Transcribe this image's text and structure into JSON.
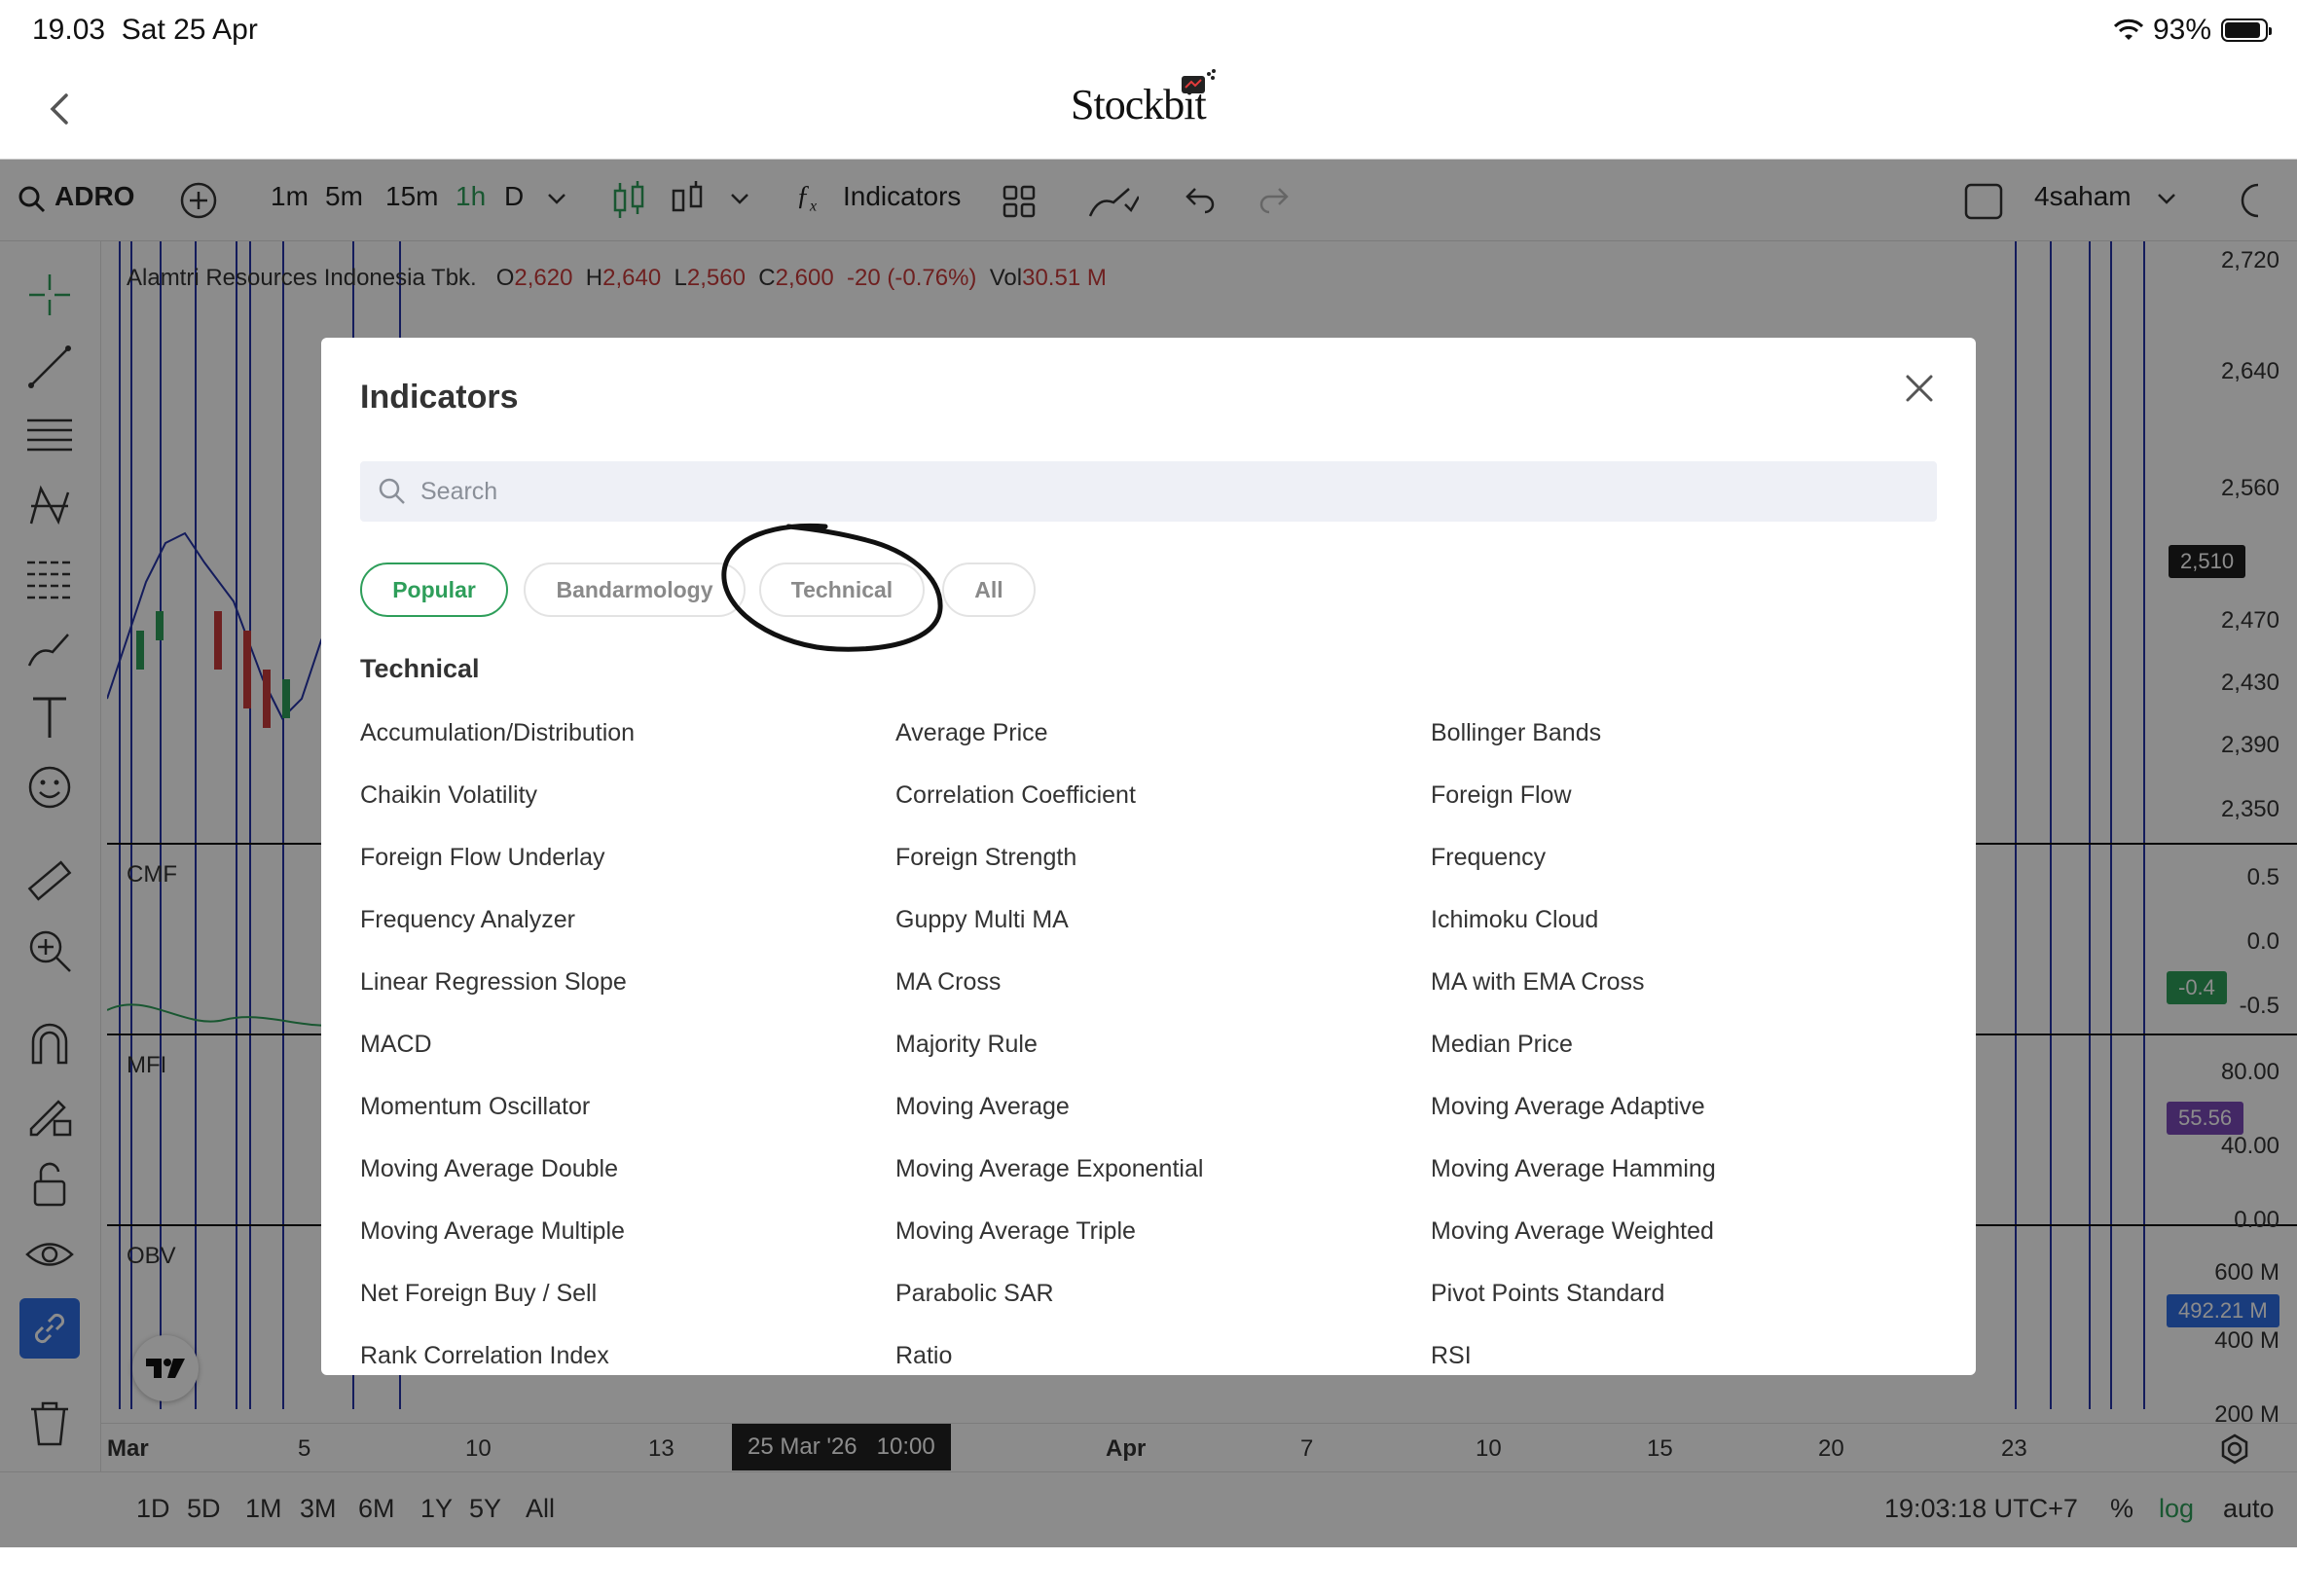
{
  "status_bar": {
    "time": "19.03",
    "date": "Sat 25 Apr",
    "battery": "93%"
  },
  "header": {
    "logo": "Stockbit",
    "back_icon": "chevron-left-icon"
  },
  "toolbar": {
    "symbol": "ADRO",
    "intervals": [
      "1m",
      "5m",
      "15m",
      "1h",
      "D"
    ],
    "active_interval": "1h",
    "indicators_label": "Indicators",
    "layout_name": "4saham",
    "accent_color": "#2e9e5a"
  },
  "chart": {
    "ticker_title": "Alamtri Resources Indonesia Tbk.",
    "ohlc": {
      "o": "2,620",
      "h": "2,640",
      "l": "2,560",
      "c": "2,600",
      "chg": "-20 (-0.76%)",
      "vol": "30.51 M"
    },
    "price_axis": [
      "2,720",
      "2,640",
      "2,560",
      "2,470",
      "2,430",
      "2,390",
      "2,350"
    ],
    "current_price": "2,510",
    "panes": [
      {
        "name": "CMF",
        "axis": [
          "0.5",
          "0.0",
          "-0.5"
        ],
        "badge": "-0.4"
      },
      {
        "name": "MFI",
        "axis": [
          "80.00",
          "40.00",
          "0.00"
        ],
        "badge": "55.56"
      },
      {
        "name": "OBV",
        "axis": [
          "600 M",
          "400 M",
          "200 M"
        ],
        "badge": "492.21 M"
      }
    ],
    "x_axis": [
      "Mar",
      "5",
      "10",
      "13",
      "Apr",
      "7",
      "10",
      "15",
      "20",
      "23"
    ],
    "crosshair_date": "25 Mar '26",
    "crosshair_time": "10:00"
  },
  "bottom_bar": {
    "ranges": [
      "1D",
      "5D",
      "1M",
      "3M",
      "6M",
      "1Y",
      "5Y",
      "All"
    ],
    "clock": "19:03:18 UTC+7",
    "percent": "%",
    "log": "log",
    "auto": "auto"
  },
  "modal": {
    "title": "Indicators",
    "search_placeholder": "Search",
    "chips": [
      "Popular",
      "Bandarmology",
      "Technical",
      "All"
    ],
    "active_chip": "Popular",
    "section": "Technical",
    "indicators": [
      [
        "Accumulation/Distribution",
        "Average Price",
        "Bollinger Bands"
      ],
      [
        "Chaikin Volatility",
        "Correlation Coefficient",
        "Foreign Flow"
      ],
      [
        "Foreign Flow Underlay",
        "Foreign Strength",
        "Frequency"
      ],
      [
        "Frequency Analyzer",
        "Guppy Multi MA",
        "Ichimoku Cloud"
      ],
      [
        "Linear Regression Slope",
        "MA Cross",
        "MA with EMA Cross"
      ],
      [
        "MACD",
        "Majority Rule",
        "Median Price"
      ],
      [
        "Momentum Oscillator",
        "Moving Average",
        "Moving Average Adaptive"
      ],
      [
        "Moving Average Double",
        "Moving Average Exponential",
        "Moving Average Hamming"
      ],
      [
        "Moving Average Multiple",
        "Moving Average Triple",
        "Moving Average Weighted"
      ],
      [
        "Net Foreign Buy / Sell",
        "Parabolic SAR",
        "Pivot Points Standard"
      ],
      [
        "Rank Correlation Index",
        "Ratio",
        "RSI"
      ]
    ]
  }
}
